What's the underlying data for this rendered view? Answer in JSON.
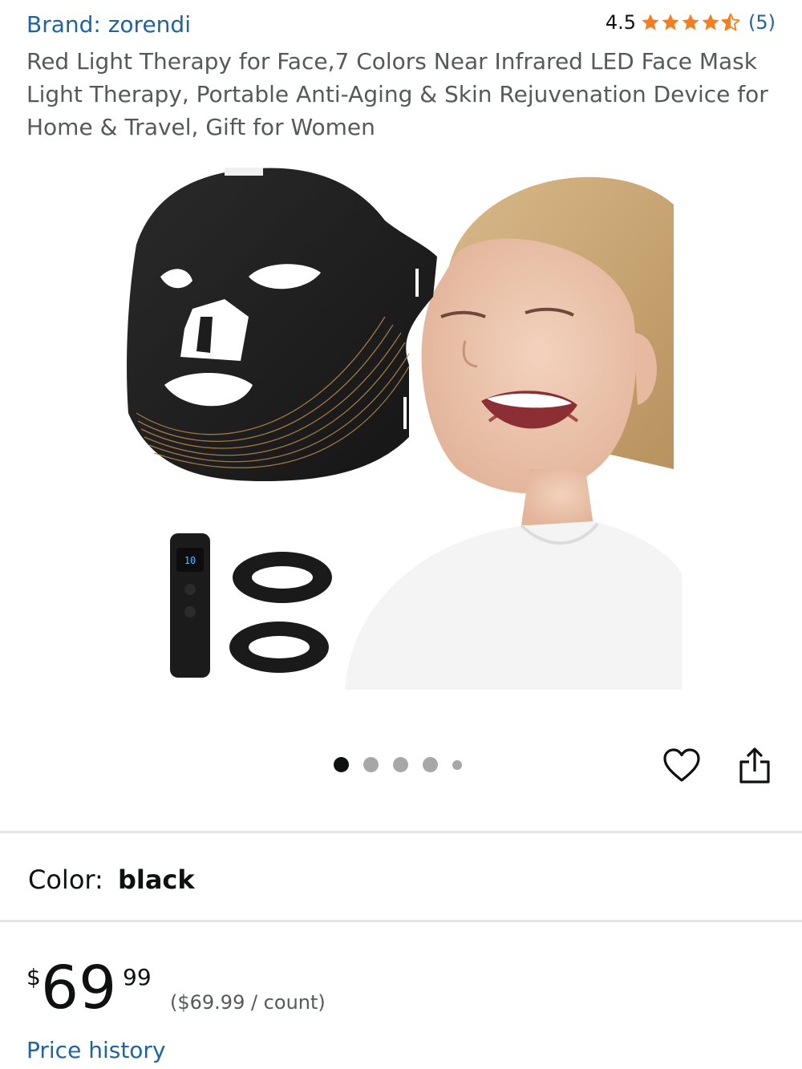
{
  "product": {
    "brand": "Brand: zorendi",
    "rating_value": "4.5",
    "rating_stars": 4.5,
    "rating_count": "(5)",
    "title": "Red Light Therapy for Face,7 Colors Near Infrared LED Face Mask Light Therapy, Portable Anti-Aging & Skin Rejuvenation Device for Home & Travel, Gift for Women"
  },
  "carousel": {
    "image_count": 5,
    "active_index": 0
  },
  "actions": {
    "wishlist_icon": "heart-outline-icon",
    "share_icon": "share-icon"
  },
  "variant": {
    "label": "Color:",
    "value": "black"
  },
  "pricing": {
    "symbol": "$",
    "whole": "69",
    "fraction": "99",
    "unit_price": "($69.99 / count)",
    "history_link": "Price history"
  },
  "colors": {
    "link": "#2162a1",
    "star": "#f47f22",
    "text": "#0f1111",
    "muted": "#565959"
  }
}
